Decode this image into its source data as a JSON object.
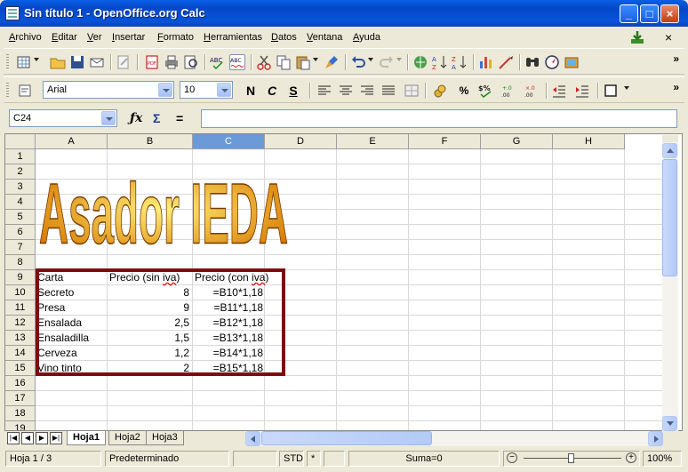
{
  "window": {
    "title": "Sin título 1 - OpenOffice.org Calc"
  },
  "menu": [
    "Archivo",
    "Editar",
    "Ver",
    "Insertar",
    "Formato",
    "Herramientas",
    "Datos",
    "Ventana",
    "Ayuda"
  ],
  "formatting": {
    "font_name": "Arial",
    "font_size": "10",
    "bold": "N",
    "italic": "C",
    "underline": "S",
    "percent": "%"
  },
  "formula_bar": {
    "cell_ref": "C24",
    "content": "",
    "sum_symbol": "Σ",
    "equals": "="
  },
  "columns": [
    "A",
    "B",
    "C",
    "D",
    "E",
    "F",
    "G",
    "H"
  ],
  "active_column": "C",
  "rows": [
    "1",
    "2",
    "3",
    "4",
    "5",
    "6",
    "7",
    "8",
    "9",
    "10",
    "11",
    "12",
    "13",
    "14",
    "15",
    "16",
    "17",
    "18",
    "19"
  ],
  "wordart": {
    "text": "Asador IEDA",
    "fill_light": "#fff07a",
    "fill_dark": "#d77a00",
    "outline": "#7a3a00"
  },
  "table": {
    "border_color": "#7b0e0e",
    "headers": [
      "Carta",
      "Precio (sin iva)",
      "Precio (con iva)"
    ],
    "rows": [
      {
        "item": "Secreto",
        "price": "8",
        "formula": "=B10*1,18"
      },
      {
        "item": "Presa",
        "price": "9",
        "formula": "=B11*1,18"
      },
      {
        "item": "Ensalada",
        "price": "2,5",
        "formula": "=B12*1,18"
      },
      {
        "item": "Ensaladilla",
        "price": "1,5",
        "formula": "=B13*1,18"
      },
      {
        "item": "Cerveza",
        "price": "1,2",
        "formula": "=B14*1,18"
      },
      {
        "item": "Vino tinto",
        "price": "2",
        "formula": "=B15*1,18"
      }
    ]
  },
  "sheet_tabs": [
    "Hoja1",
    "Hoja2",
    "Hoja3"
  ],
  "active_tab": "Hoja1",
  "status": {
    "sheet": "Hoja 1 / 3",
    "style": "Predeterminado",
    "mode": "STD",
    "modified": "*",
    "sum": "Suma=0",
    "zoom": "100%"
  },
  "colors": {
    "titlebar": "#0548c8",
    "active_header": "#6a9bd8",
    "chrome": "#ece9d8"
  }
}
